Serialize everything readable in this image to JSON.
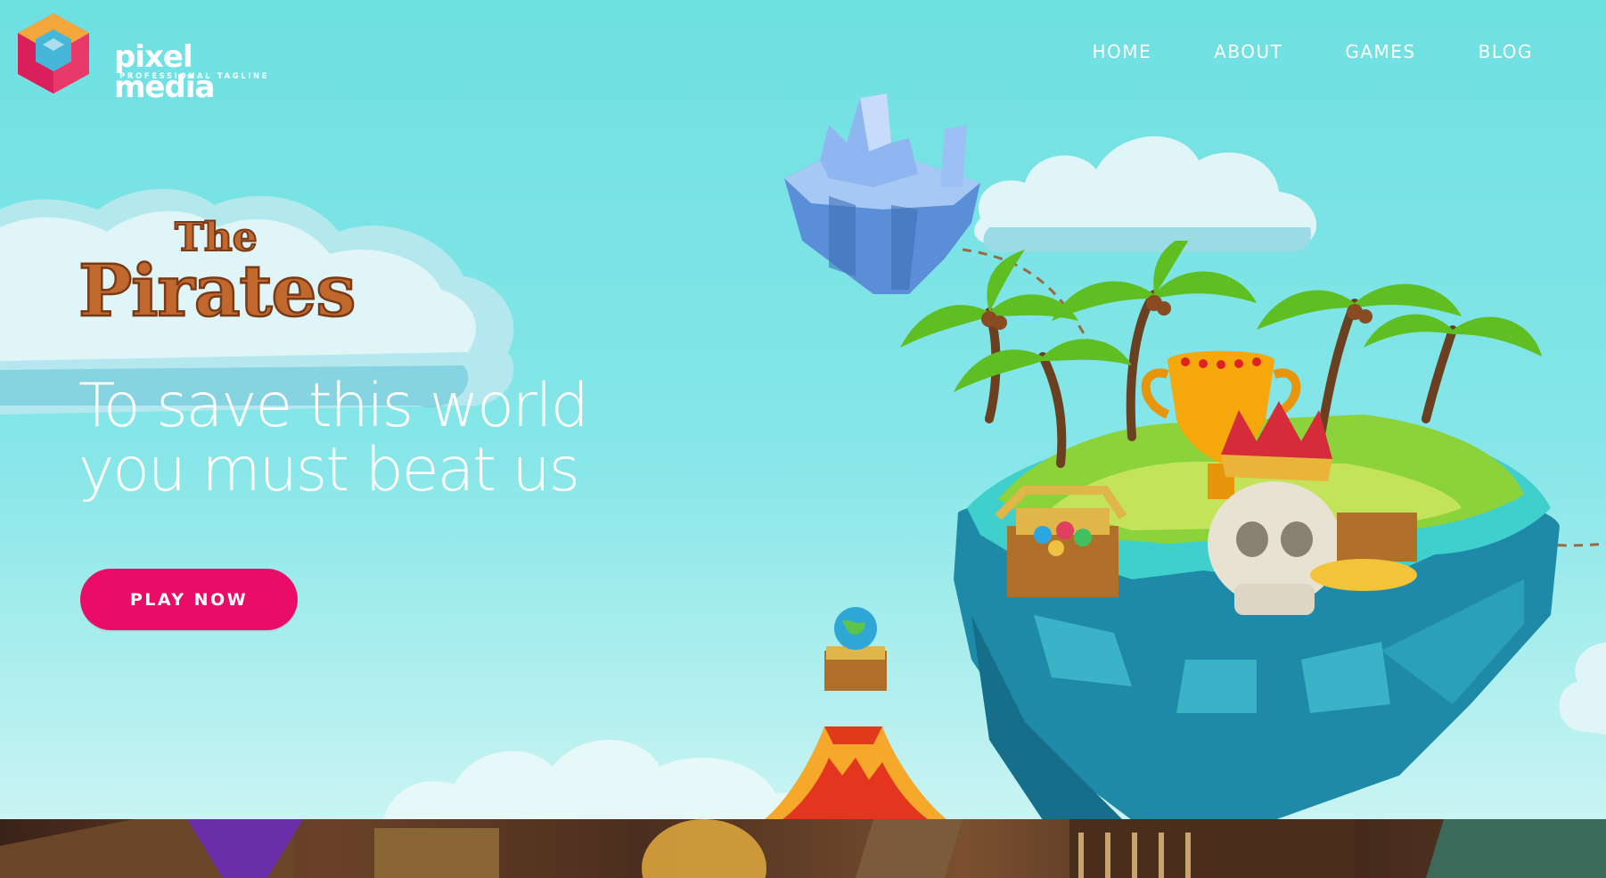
{
  "header": {
    "logo": {
      "name": "pixel media",
      "tagline": "PROFESSIONAL TAGLINE"
    },
    "nav": [
      {
        "label": "HOME"
      },
      {
        "label": "ABOUT"
      },
      {
        "label": "GAMES"
      },
      {
        "label": "BLOG"
      }
    ]
  },
  "hero": {
    "title_logo": "The Pirates",
    "headline_line1": "To save this world",
    "headline_line2": "you must beat us",
    "cta_label": "PLAY NOW"
  },
  "colors": {
    "sky": "#6ee0e2",
    "accent": "#ea0d68",
    "text": "#ffffff"
  },
  "icons": {
    "logo": "hexagon-cube-icon",
    "illustration": "floating-islands-treasure"
  }
}
